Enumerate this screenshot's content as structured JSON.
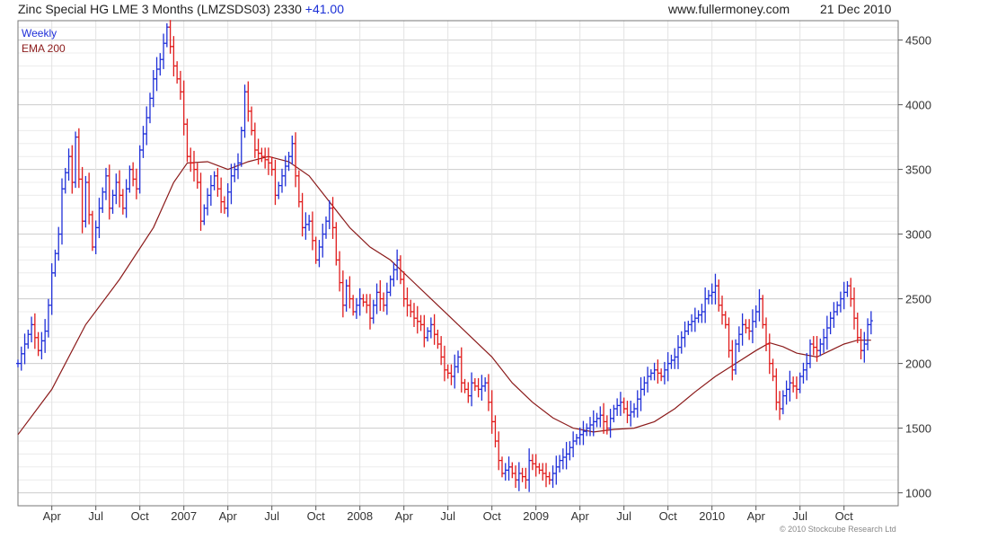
{
  "header": {
    "title": "Zinc Special HG LME 3 Months (LMZSDS03) 2330",
    "change": "+41.00",
    "site": "www.fullermoney.com",
    "date": "21 Dec 2010"
  },
  "footer": {
    "copyright": "© 2010 Stockcube Research Ltd"
  },
  "colors": {
    "up": "#1f2fd8",
    "down": "#e01b1b",
    "ema": "#8b1a1a",
    "grid": "#d9d9d9",
    "axis": "#555555"
  },
  "chart_data": {
    "type": "line",
    "title": "Zinc Special HG LME 3 Months (LMZSDS03)",
    "legend": [
      "Weekly",
      "EMA 200"
    ],
    "legend_position": "top-left",
    "y_axis_position": "right",
    "ylim": [
      900,
      4650
    ],
    "yticks": [
      1000,
      1500,
      2000,
      2500,
      3000,
      3500,
      4000,
      4500
    ],
    "xlim": [
      0,
      260
    ],
    "xticks": [
      {
        "x": 10,
        "label": "Apr"
      },
      {
        "x": 23,
        "label": "Jul"
      },
      {
        "x": 36,
        "label": "Oct"
      },
      {
        "x": 49,
        "label": "2007"
      },
      {
        "x": 62,
        "label": "Apr"
      },
      {
        "x": 75,
        "label": "Jul"
      },
      {
        "x": 88,
        "label": "Oct"
      },
      {
        "x": 101,
        "label": "2008"
      },
      {
        "x": 114,
        "label": "Apr"
      },
      {
        "x": 127,
        "label": "Jul"
      },
      {
        "x": 140,
        "label": "Oct"
      },
      {
        "x": 153,
        "label": "2009"
      },
      {
        "x": 166,
        "label": "Apr"
      },
      {
        "x": 179,
        "label": "Jul"
      },
      {
        "x": 192,
        "label": "Oct"
      },
      {
        "x": 205,
        "label": "2010"
      },
      {
        "x": 218,
        "label": "Apr"
      },
      {
        "x": 231,
        "label": "Jul"
      },
      {
        "x": 244,
        "label": "Oct"
      }
    ],
    "grid": true,
    "series": [
      {
        "name": "Weekly",
        "style": "ohlc-bars",
        "points": [
          [
            0,
            2000
          ],
          [
            2,
            2150
          ],
          [
            4,
            2300
          ],
          [
            6,
            2100
          ],
          [
            8,
            2250
          ],
          [
            9,
            2450
          ],
          [
            10,
            2700
          ],
          [
            12,
            3000
          ],
          [
            13,
            3350
          ],
          [
            15,
            3600
          ],
          [
            16,
            3400
          ],
          [
            17,
            3750
          ],
          [
            19,
            3100
          ],
          [
            20,
            3400
          ],
          [
            22,
            2900
          ],
          [
            24,
            3200
          ],
          [
            26,
            3450
          ],
          [
            27,
            3200
          ],
          [
            29,
            3400
          ],
          [
            31,
            3200
          ],
          [
            33,
            3500
          ],
          [
            35,
            3350
          ],
          [
            36,
            3650
          ],
          [
            38,
            3900
          ],
          [
            40,
            4200
          ],
          [
            42,
            4350
          ],
          [
            44,
            4600
          ],
          [
            45,
            4450
          ],
          [
            46,
            4300
          ],
          [
            48,
            4100
          ],
          [
            49,
            3850
          ],
          [
            50,
            3600
          ],
          [
            52,
            3500
          ],
          [
            53,
            3400
          ],
          [
            54,
            3100
          ],
          [
            56,
            3300
          ],
          [
            58,
            3450
          ],
          [
            60,
            3250
          ],
          [
            61,
            3200
          ],
          [
            63,
            3450
          ],
          [
            65,
            3550
          ],
          [
            66,
            3800
          ],
          [
            67,
            4100
          ],
          [
            68,
            3950
          ],
          [
            70,
            3650
          ],
          [
            72,
            3600
          ],
          [
            74,
            3550
          ],
          [
            75,
            3500
          ],
          [
            76,
            3300
          ],
          [
            78,
            3450
          ],
          [
            80,
            3600
          ],
          [
            81,
            3700
          ],
          [
            82,
            3450
          ],
          [
            83,
            3250
          ],
          [
            84,
            3050
          ],
          [
            86,
            3100
          ],
          [
            88,
            2800
          ],
          [
            90,
            3000
          ],
          [
            92,
            3200
          ],
          [
            93,
            3050
          ],
          [
            94,
            2800
          ],
          [
            96,
            2450
          ],
          [
            97,
            2600
          ],
          [
            99,
            2400
          ],
          [
            101,
            2500
          ],
          [
            103,
            2450
          ],
          [
            104,
            2350
          ],
          [
            106,
            2550
          ],
          [
            108,
            2450
          ],
          [
            110,
            2650
          ],
          [
            112,
            2800
          ],
          [
            113,
            2650
          ],
          [
            114,
            2500
          ],
          [
            116,
            2400
          ],
          [
            117,
            2350
          ],
          [
            119,
            2300
          ],
          [
            120,
            2200
          ],
          [
            122,
            2300
          ],
          [
            124,
            2150
          ],
          [
            125,
            2050
          ],
          [
            126,
            1950
          ],
          [
            128,
            1900
          ],
          [
            130,
            2050
          ],
          [
            131,
            1850
          ],
          [
            133,
            1750
          ],
          [
            134,
            1850
          ],
          [
            136,
            1800
          ],
          [
            138,
            1850
          ],
          [
            139,
            1700
          ],
          [
            140,
            1550
          ],
          [
            141,
            1400
          ],
          [
            142,
            1250
          ],
          [
            143,
            1150
          ],
          [
            145,
            1200
          ],
          [
            147,
            1100
          ],
          [
            148,
            1150
          ],
          [
            150,
            1100
          ],
          [
            151,
            1250
          ],
          [
            153,
            1200
          ],
          [
            155,
            1150
          ],
          [
            157,
            1100
          ],
          [
            158,
            1150
          ],
          [
            160,
            1250
          ],
          [
            162,
            1300
          ],
          [
            164,
            1400
          ],
          [
            166,
            1450
          ],
          [
            168,
            1500
          ],
          [
            170,
            1550
          ],
          [
            172,
            1600
          ],
          [
            174,
            1500
          ],
          [
            176,
            1650
          ],
          [
            178,
            1700
          ],
          [
            180,
            1600
          ],
          [
            182,
            1650
          ],
          [
            184,
            1800
          ],
          [
            186,
            1900
          ],
          [
            188,
            1950
          ],
          [
            190,
            1900
          ],
          [
            192,
            2000
          ],
          [
            194,
            2050
          ],
          [
            196,
            2200
          ],
          [
            198,
            2300
          ],
          [
            200,
            2350
          ],
          [
            202,
            2400
          ],
          [
            203,
            2500
          ],
          [
            205,
            2550
          ],
          [
            206,
            2600
          ],
          [
            207,
            2450
          ],
          [
            209,
            2300
          ],
          [
            210,
            2100
          ],
          [
            211,
            1950
          ],
          [
            212,
            2150
          ],
          [
            214,
            2300
          ],
          [
            216,
            2250
          ],
          [
            218,
            2400
          ],
          [
            219,
            2500
          ],
          [
            220,
            2300
          ],
          [
            221,
            2150
          ],
          [
            222,
            2000
          ],
          [
            223,
            1900
          ],
          [
            224,
            1700
          ],
          [
            225,
            1650
          ],
          [
            226,
            1750
          ],
          [
            228,
            1850
          ],
          [
            230,
            1800
          ],
          [
            231,
            1900
          ],
          [
            233,
            2000
          ],
          [
            234,
            2150
          ],
          [
            236,
            2100
          ],
          [
            238,
            2200
          ],
          [
            240,
            2350
          ],
          [
            242,
            2450
          ],
          [
            244,
            2550
          ],
          [
            245,
            2600
          ],
          [
            246,
            2500
          ],
          [
            247,
            2350
          ],
          [
            248,
            2200
          ],
          [
            249,
            2100
          ],
          [
            250,
            2150
          ],
          [
            251,
            2300
          ],
          [
            252,
            2330
          ]
        ]
      },
      {
        "name": "EMA 200",
        "style": "line",
        "points": [
          [
            0,
            1450
          ],
          [
            10,
            1800
          ],
          [
            20,
            2300
          ],
          [
            30,
            2650
          ],
          [
            40,
            3050
          ],
          [
            46,
            3400
          ],
          [
            50,
            3550
          ],
          [
            56,
            3560
          ],
          [
            62,
            3500
          ],
          [
            68,
            3560
          ],
          [
            74,
            3600
          ],
          [
            80,
            3560
          ],
          [
            86,
            3450
          ],
          [
            92,
            3250
          ],
          [
            98,
            3050
          ],
          [
            104,
            2900
          ],
          [
            110,
            2800
          ],
          [
            116,
            2650
          ],
          [
            122,
            2500
          ],
          [
            128,
            2350
          ],
          [
            134,
            2200
          ],
          [
            140,
            2050
          ],
          [
            146,
            1850
          ],
          [
            152,
            1700
          ],
          [
            158,
            1580
          ],
          [
            164,
            1500
          ],
          [
            170,
            1470
          ],
          [
            176,
            1490
          ],
          [
            182,
            1500
          ],
          [
            188,
            1550
          ],
          [
            194,
            1650
          ],
          [
            200,
            1780
          ],
          [
            206,
            1900
          ],
          [
            212,
            2000
          ],
          [
            218,
            2100
          ],
          [
            222,
            2160
          ],
          [
            226,
            2130
          ],
          [
            230,
            2080
          ],
          [
            236,
            2050
          ],
          [
            240,
            2100
          ],
          [
            244,
            2150
          ],
          [
            248,
            2180
          ],
          [
            252,
            2180
          ]
        ]
      }
    ]
  }
}
